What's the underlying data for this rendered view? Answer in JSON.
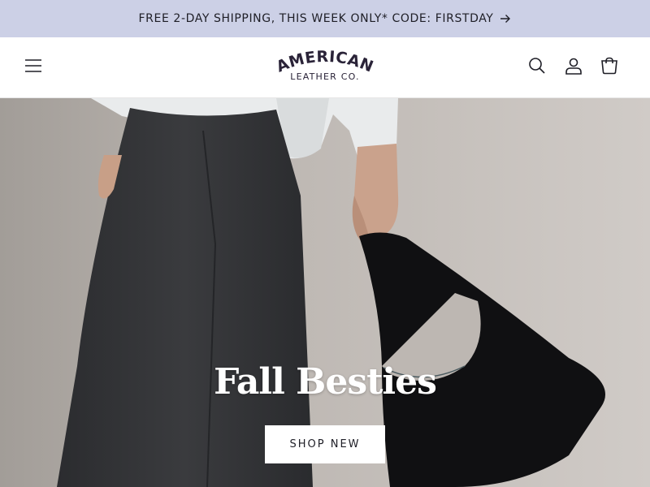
{
  "announcement": {
    "text": "FREE 2-DAY SHIPPING, THIS WEEK ONLY* CODE: FIRSTDAY",
    "arrow_icon": "arrow-right-icon",
    "background": "#ccd0e6"
  },
  "header": {
    "logo": {
      "wordmark": "AMERICAN",
      "tagline": "LEATHER CO.",
      "color": "#2a2338"
    },
    "icons": {
      "menu": "hamburger-menu-icon",
      "search": "search-icon",
      "account": "account-icon",
      "cart": "cart-icon"
    }
  },
  "hero": {
    "title": "Fall Besties",
    "cta_label": "SHOP NEW",
    "image_subject": "person in white shirt and dark wide-leg trousers holding a black suede shoulder bag"
  }
}
